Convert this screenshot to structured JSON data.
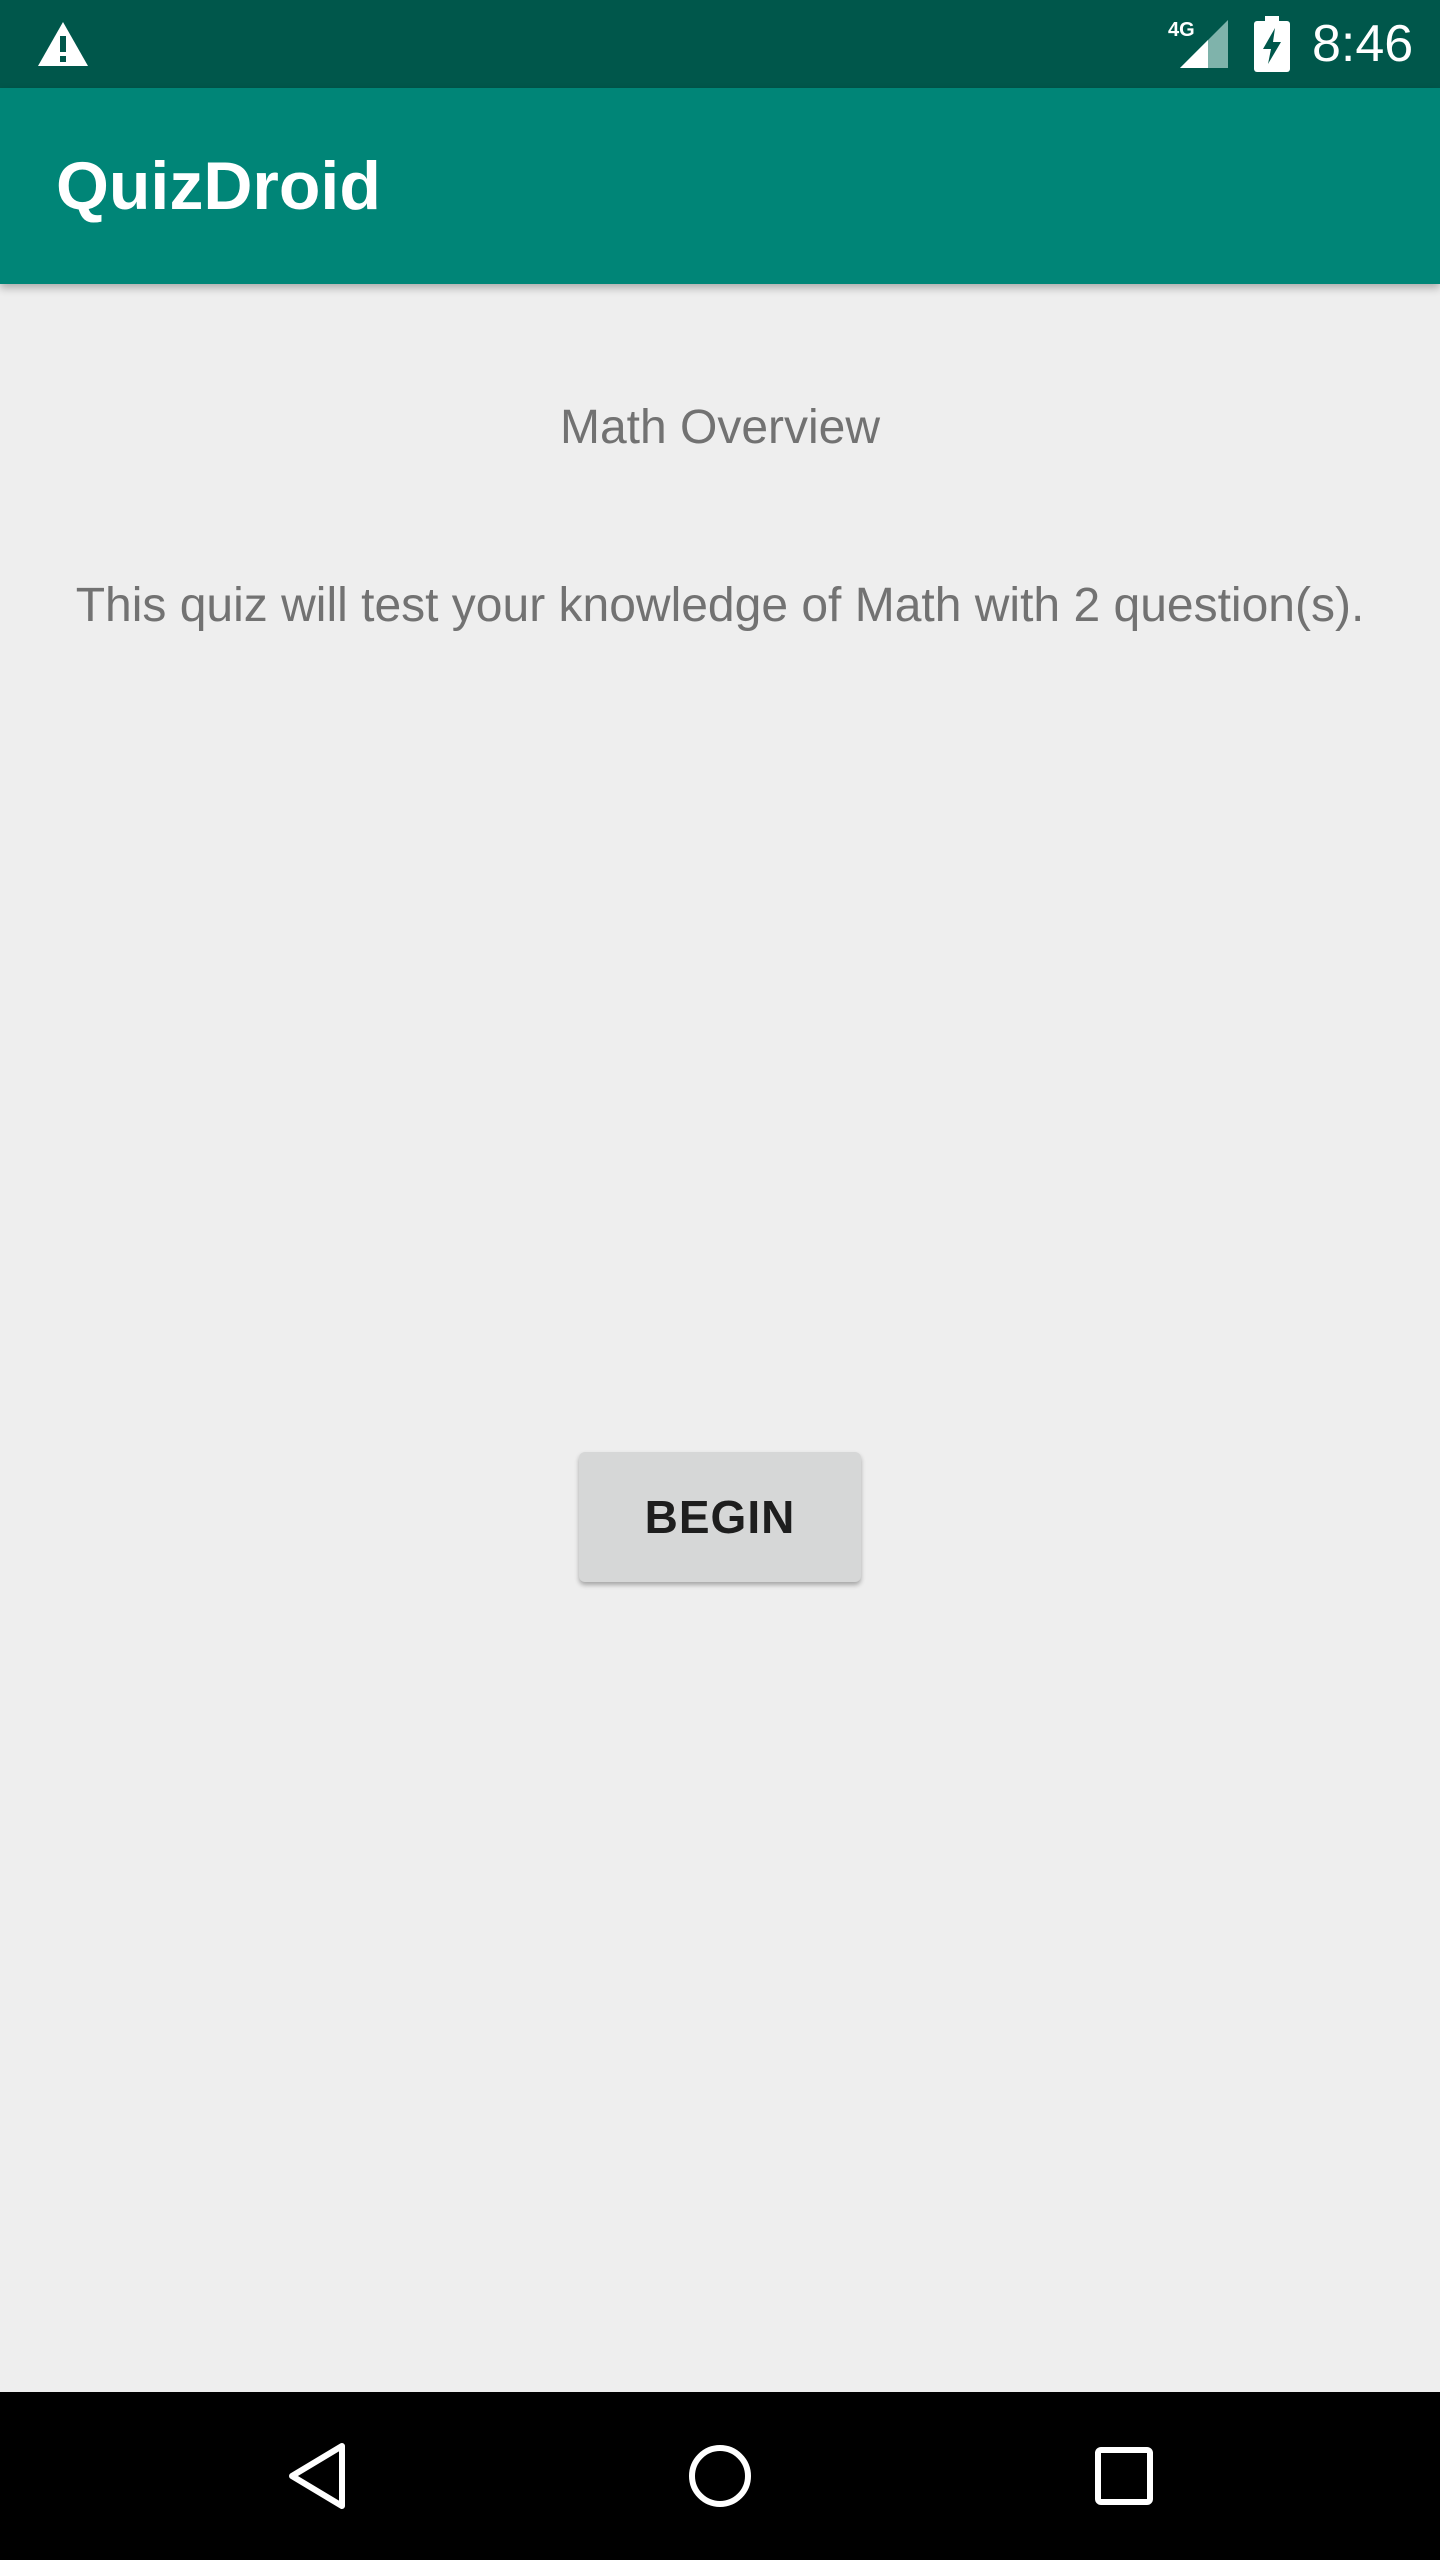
{
  "status_bar": {
    "time": "8:46",
    "network_label": "4G",
    "icons": [
      "warning-icon",
      "signal-icon",
      "battery-charging-icon"
    ]
  },
  "app_bar": {
    "title": "QuizDroid"
  },
  "main": {
    "topic_title": "Math Overview",
    "description": "This quiz will test your knowledge of Math with 2 question(s).",
    "begin_label": "BEGIN"
  },
  "nav_bar": {
    "icons": [
      "back-icon",
      "home-icon",
      "recents-icon"
    ]
  },
  "colors": {
    "status_bar": "#00574b",
    "app_bar": "#008577",
    "background": "#eeeeee",
    "button": "#d6d7d7",
    "text_secondary": "#727272"
  }
}
